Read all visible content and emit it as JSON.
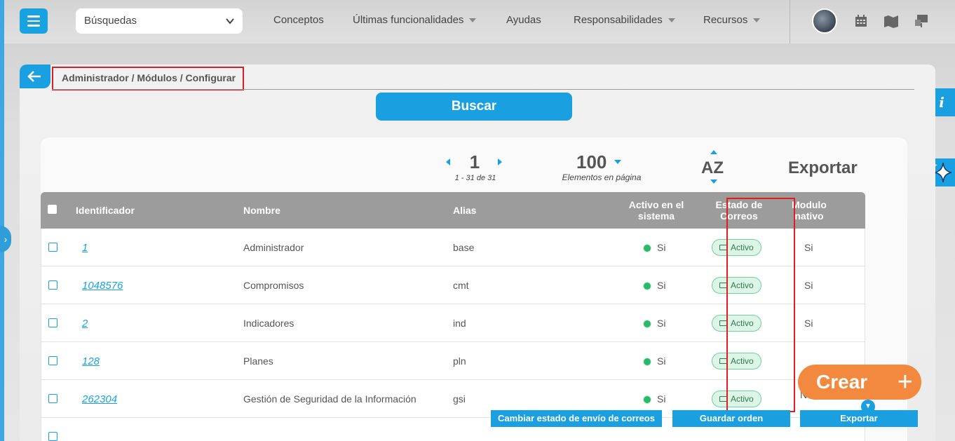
{
  "topbar": {
    "search_select_value": "Búsquedas",
    "nav": [
      {
        "label": "Conceptos"
      },
      {
        "label": "Últimas funcionalidades"
      },
      {
        "label": "Ayudas"
      },
      {
        "label": "Responsabilidades"
      },
      {
        "label": "Recursos"
      }
    ]
  },
  "breadcrumb": "Administrador / Módulos / Configurar",
  "search_button": "Buscar",
  "pagination": {
    "page": "1",
    "range_start": "1",
    "range_sep": " - ",
    "range_end": "31",
    "range_of": " de ",
    "total": "31",
    "per_page": "100",
    "per_page_label": "Elementos en página",
    "sort_label": "AZ",
    "export_label": "Exportar"
  },
  "table": {
    "headers": {
      "identificador": "Identificador",
      "nombre": "Nombre",
      "alias": "Alias",
      "activo_line1": "Activo en el",
      "activo_line2": "sistema",
      "estado_line1": "Estado de",
      "estado_line2": "Correos",
      "nativo_line1": "Modulo",
      "nativo_line2": "nativo"
    },
    "rows": [
      {
        "id": "1",
        "nombre": "Administrador",
        "alias": "base",
        "activo": "Si",
        "estado": "Activo",
        "nativo": "Si"
      },
      {
        "id": "1048576",
        "nombre": "Compromisos",
        "alias": "cmt",
        "activo": "Si",
        "estado": "Activo",
        "nativo": "Si"
      },
      {
        "id": "2",
        "nombre": "Indicadores",
        "alias": "ind",
        "activo": "Si",
        "estado": "Activo",
        "nativo": "Si"
      },
      {
        "id": "128",
        "nombre": "Planes",
        "alias": "pln",
        "activo": "Si",
        "estado": "Activo",
        "nativo": ""
      },
      {
        "id": "262304",
        "nombre": "Gestión de Seguridad de la Información",
        "alias": "gsi",
        "activo": "Si",
        "estado": "Activo",
        "nativo": "No"
      }
    ]
  },
  "crear_button": "Crear",
  "bottom_actions": {
    "cambiar": "Cambiar estado de envío de correos",
    "guardar": "Guardar orden",
    "exportar": "Exportar"
  },
  "colors": {
    "accent": "#1aa0e0",
    "crear": "#f3893e",
    "active_dot": "#29b96a",
    "highlight": "#e01e1e"
  }
}
